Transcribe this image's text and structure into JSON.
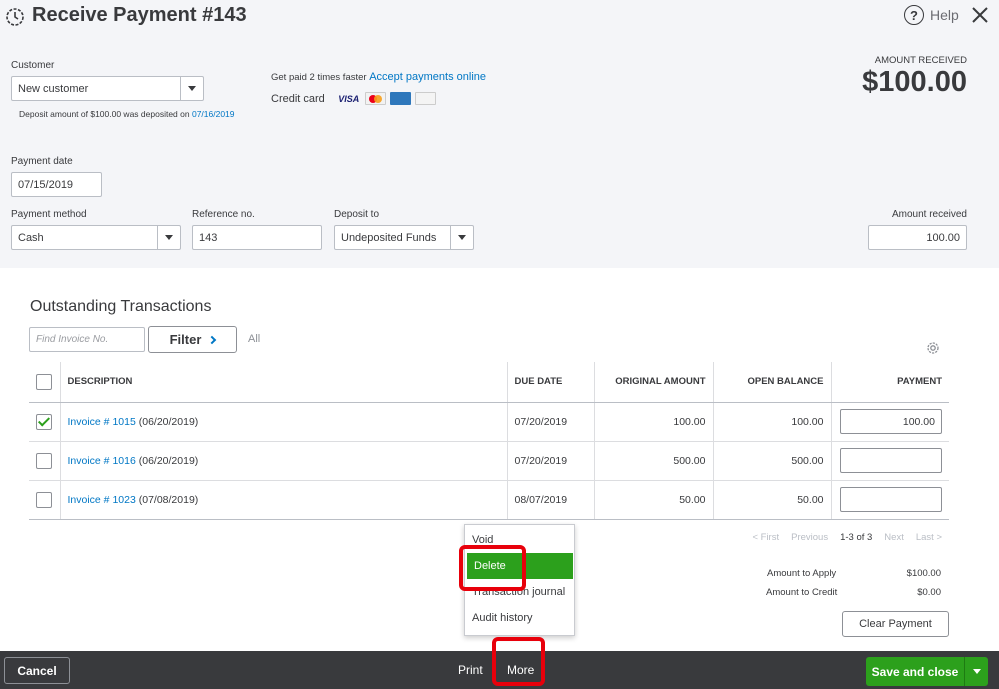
{
  "header": {
    "title": "Receive Payment #143",
    "help_label": "Help"
  },
  "customer": {
    "label": "Customer",
    "value": "New customer",
    "deposit_note_prefix": "Deposit amount of $100.00 was deposited on",
    "deposit_note_date": "07/16/2019"
  },
  "promo": {
    "text": "Get paid 2 times faster",
    "link": "Accept payments online",
    "credit_card_label": "Credit card",
    "cards": [
      "VISA",
      "MasterCard",
      "AMEX",
      "DISCOVER"
    ]
  },
  "amount_received_header": {
    "label": "AMOUNT RECEIVED",
    "value": "$100.00"
  },
  "payment_date": {
    "label": "Payment date",
    "value": "07/15/2019"
  },
  "payment_method": {
    "label": "Payment method",
    "value": "Cash"
  },
  "reference_no": {
    "label": "Reference no.",
    "value": "143"
  },
  "deposit_to": {
    "label": "Deposit to",
    "value": "Undeposited Funds"
  },
  "amount_received": {
    "label": "Amount received",
    "value": "100.00"
  },
  "outstanding": {
    "title": "Outstanding Transactions",
    "find_placeholder": "Find Invoice No.",
    "filter_label": "Filter",
    "all_label": "All",
    "columns": [
      "DESCRIPTION",
      "DUE DATE",
      "ORIGINAL AMOUNT",
      "OPEN BALANCE",
      "PAYMENT"
    ],
    "rows": [
      {
        "checked": true,
        "invoice": "Invoice # 1015",
        "date": "(06/20/2019)",
        "due": "07/20/2019",
        "original": "100.00",
        "open": "100.00",
        "payment": "100.00"
      },
      {
        "checked": false,
        "invoice": "Invoice # 1016",
        "date": "(06/20/2019)",
        "due": "07/20/2019",
        "original": "500.00",
        "open": "500.00",
        "payment": ""
      },
      {
        "checked": false,
        "invoice": "Invoice # 1023",
        "date": "(07/08/2019)",
        "due": "08/07/2019",
        "original": "50.00",
        "open": "50.00",
        "payment": ""
      }
    ]
  },
  "pager": {
    "first": "< First",
    "previous": "Previous",
    "range": "1-3 of 3",
    "next": "Next",
    "last": "Last >"
  },
  "summary": {
    "apply_label": "Amount to Apply",
    "apply_value": "$100.00",
    "credit_label": "Amount to Credit",
    "credit_value": "$0.00",
    "clear_label": "Clear Payment"
  },
  "more_menu": {
    "items": [
      "Void",
      "Delete",
      "Transaction journal",
      "Audit history"
    ],
    "selected": "Delete"
  },
  "footer": {
    "cancel_label": "Cancel",
    "print_label": "Print",
    "more_label": "More",
    "save_label": "Save and close"
  },
  "colors": {
    "accent_green": "#2ca01c",
    "link_blue": "#0077c5",
    "footer_bg": "#393a3d",
    "highlight_red": "#e8000b"
  }
}
